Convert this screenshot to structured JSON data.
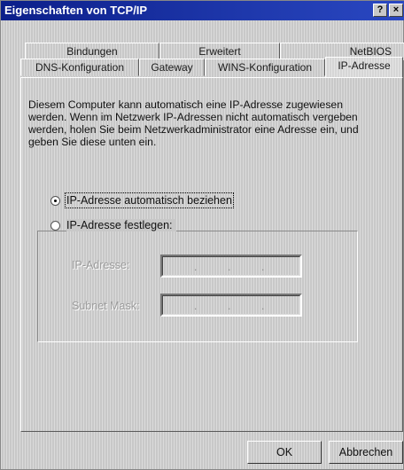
{
  "window": {
    "title": "Eigenschaften von TCP/IP",
    "help_button": "?",
    "close_button": "×"
  },
  "tabs": {
    "row_back": [
      {
        "label": "Bindungen"
      },
      {
        "label": "Erweitert"
      },
      {
        "label": "NetBIOS"
      }
    ],
    "row_front": [
      {
        "label": "DNS-Konfiguration"
      },
      {
        "label": "Gateway"
      },
      {
        "label": "WINS-Konfiguration"
      },
      {
        "label": "IP-Adresse",
        "active": true
      }
    ]
  },
  "description": "Diesem Computer kann automatisch eine IP-Adresse zugewiesen werden. Wenn im Netzwerk IP-Adressen nicht automatisch vergeben werden, holen Sie beim Netzwerkadministrator eine Adresse ein, und geben Sie diese unten ein.",
  "options": {
    "auto": {
      "label": "IP-Adresse automatisch beziehen",
      "selected": true
    },
    "manual": {
      "label": "IP-Adresse festlegen:",
      "selected": false
    }
  },
  "fields": {
    "ip_label": "IP-Adresse:",
    "subnet_label": "Subnet Mask:",
    "separator": "."
  },
  "buttons": {
    "ok": "OK",
    "cancel": "Abbrechen"
  }
}
